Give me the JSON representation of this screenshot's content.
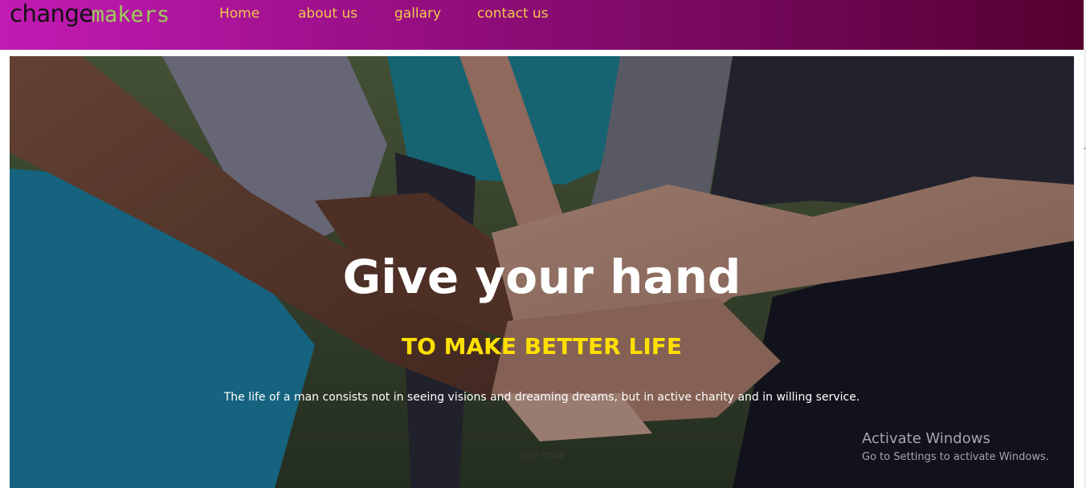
{
  "brand": {
    "part1": "change",
    "part2": "makers"
  },
  "nav": {
    "items": [
      {
        "label": "Home"
      },
      {
        "label": "about us"
      },
      {
        "label": "gallary"
      },
      {
        "label": "contact us"
      }
    ]
  },
  "hero": {
    "title": "Give your hand",
    "subtitle": "TO MAKE BETTER LIFE",
    "quote": "The life of a man consists not in seeing visions and dreaming dreams, but in active charity and in willing service.",
    "button_label": "Join now"
  },
  "watermark": {
    "title": "Activate Windows",
    "subtitle": "Go to Settings to activate Windows."
  },
  "colors": {
    "nav_gradient_start": "#c21bb4",
    "nav_gradient_end": "#55002f",
    "nav_link": "#f2c94c",
    "subtitle_yellow": "#ffe000",
    "logo_accent": "#9bd05a"
  }
}
